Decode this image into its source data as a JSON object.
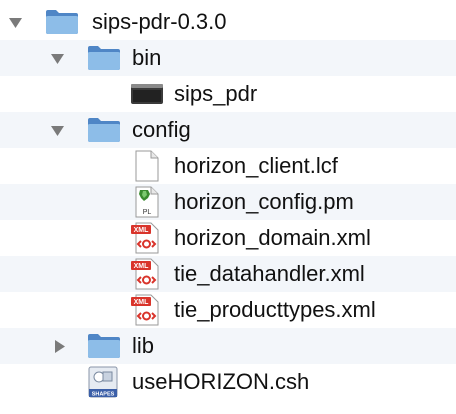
{
  "file_tree": {
    "root": {
      "label": "sips-pdr-0.3.0",
      "expanded": true,
      "icon": "folder-icon"
    },
    "bin": {
      "label": "bin",
      "expanded": true,
      "icon": "folder-icon"
    },
    "sips_pdr": {
      "label": "sips_pdr",
      "icon": "executable-icon"
    },
    "config": {
      "label": "config",
      "expanded": true,
      "icon": "folder-icon"
    },
    "horizon_client": {
      "label": "horizon_client.lcf",
      "icon": "document-icon"
    },
    "horizon_config": {
      "label": "horizon_config.pm",
      "icon": "perl-file-icon",
      "badge": "PL"
    },
    "horizon_domain": {
      "label": "horizon_domain.xml",
      "icon": "xml-file-icon",
      "badge": "XML"
    },
    "tie_datahandler": {
      "label": "tie_datahandler.xml",
      "icon": "xml-file-icon",
      "badge": "XML"
    },
    "tie_producttypes": {
      "label": "tie_producttypes.xml",
      "icon": "xml-file-icon",
      "badge": "XML"
    },
    "lib": {
      "label": "lib",
      "expanded": false,
      "icon": "folder-icon"
    },
    "usehorizon": {
      "label": "useHORIZON.csh",
      "icon": "shell-script-icon",
      "badge": "SHAPES"
    }
  },
  "colors": {
    "folder": "#6fa8dc",
    "folder_dark": "#4f86c6",
    "row_alt": "#f3f6fa",
    "xml_red": "#d9342b",
    "perl_green": "#3a8b2f"
  }
}
